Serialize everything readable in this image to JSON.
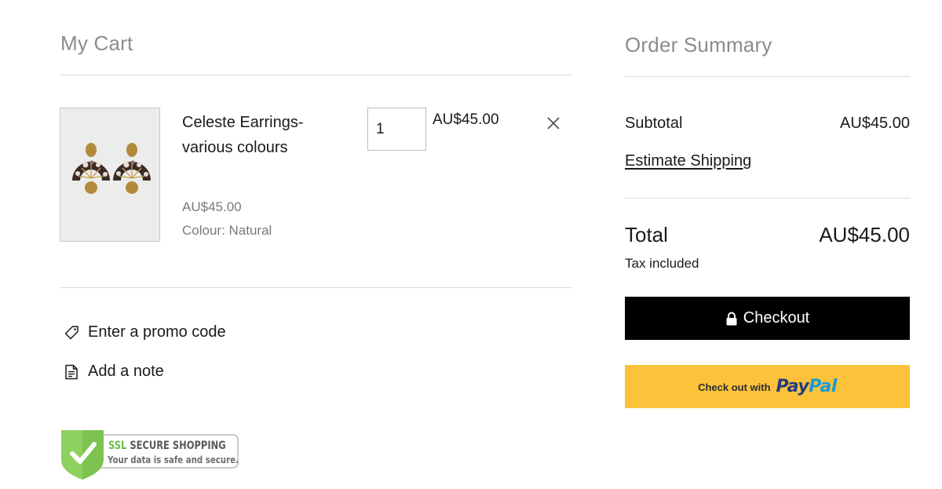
{
  "cart": {
    "title": "My Cart",
    "items": [
      {
        "name": "Celeste Earrings- various colours",
        "price": "AU$45.00",
        "option": "Colour: Natural",
        "quantity": "1",
        "line_total": "AU$45.00"
      }
    ],
    "promo_label": "Enter a promo code",
    "note_label": "Add a note"
  },
  "ssl_badge": {
    "title_highlight": "SSL",
    "title_rest": "SECURE SHOPPING",
    "subtitle": "Your data is safe and secure."
  },
  "summary": {
    "title": "Order Summary",
    "subtotal_label": "Subtotal",
    "subtotal_value": "AU$45.00",
    "estimate_shipping_label": "Estimate Shipping",
    "total_label": "Total",
    "total_value": "AU$45.00",
    "tax_note": "Tax included",
    "checkout_label": "Checkout",
    "paypal_prefix": "Check out with",
    "paypal_brand_dark": "Pay",
    "paypal_brand_light": "Pal"
  },
  "colors": {
    "accent_black": "#000000",
    "paypal_yellow": "#fcc23a",
    "paypal_blue_dark": "#253b80",
    "paypal_blue_light": "#179bd7",
    "ssl_green": "#6cbd45",
    "muted_text": "#8c8c8c"
  },
  "icons": {
    "remove": "close-icon",
    "promo": "tag-icon",
    "note": "note-icon",
    "checkout": "lock-icon",
    "ssl": "shield-check-icon"
  }
}
